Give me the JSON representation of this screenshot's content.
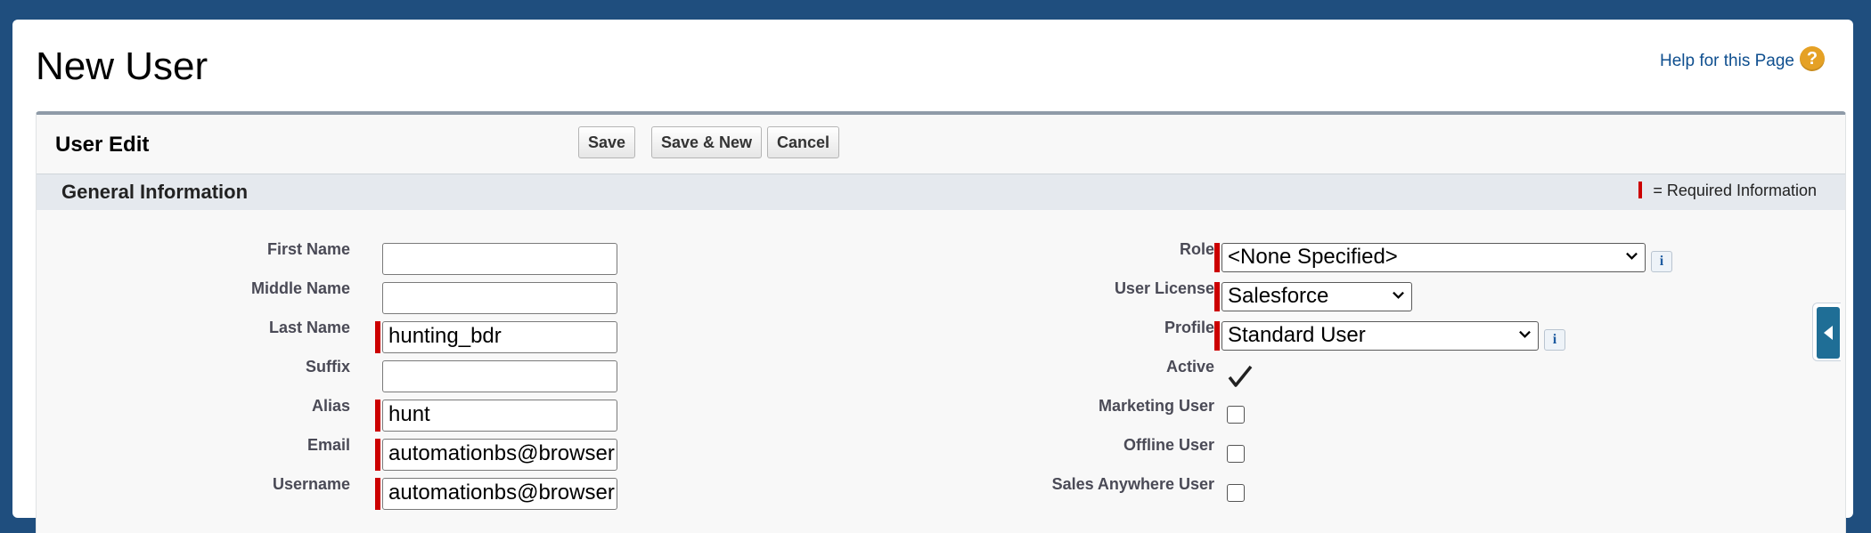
{
  "page": {
    "title": "New User",
    "help_link": "Help for this Page",
    "help_icon": "?"
  },
  "panel": {
    "title": "User Edit",
    "buttons": {
      "save": "Save",
      "save_new": "Save & New",
      "cancel": "Cancel"
    }
  },
  "section": {
    "title": "General Information",
    "required_legend": "= Required Information"
  },
  "left_fields": [
    {
      "label": "First Name",
      "value": "",
      "required": false
    },
    {
      "label": "Middle Name",
      "value": "",
      "required": false
    },
    {
      "label": "Last Name",
      "value": "hunting_bdr",
      "required": true
    },
    {
      "label": "Suffix",
      "value": "",
      "required": false
    },
    {
      "label": "Alias",
      "value": "hunt",
      "required": true
    },
    {
      "label": "Email",
      "value": "automationbs@browser",
      "required": true
    },
    {
      "label": "Username",
      "value": "automationbs@browser",
      "required": true
    }
  ],
  "right_fields": {
    "role": {
      "label": "Role",
      "value": "<None Specified>"
    },
    "user_license": {
      "label": "User License",
      "value": "Salesforce"
    },
    "profile": {
      "label": "Profile",
      "value": "Standard User"
    },
    "active": {
      "label": "Active",
      "checked": true
    },
    "marketing_user": {
      "label": "Marketing User",
      "checked": false
    },
    "offline_user": {
      "label": "Offline User",
      "checked": false
    },
    "sales_anywhere_user": {
      "label": "Sales Anywhere User",
      "checked": false
    }
  },
  "info_icon_glyph": "i",
  "icons": [
    "help-icon",
    "info-icon",
    "chevron-down-icon",
    "checkmark-icon",
    "collapse-arrow-icon"
  ],
  "colors": {
    "background": "#1f4e7e",
    "required": "#cc0000",
    "link": "#0f4f8f",
    "help_icon": "#e5a125",
    "section_header": "#e5e9ee"
  }
}
